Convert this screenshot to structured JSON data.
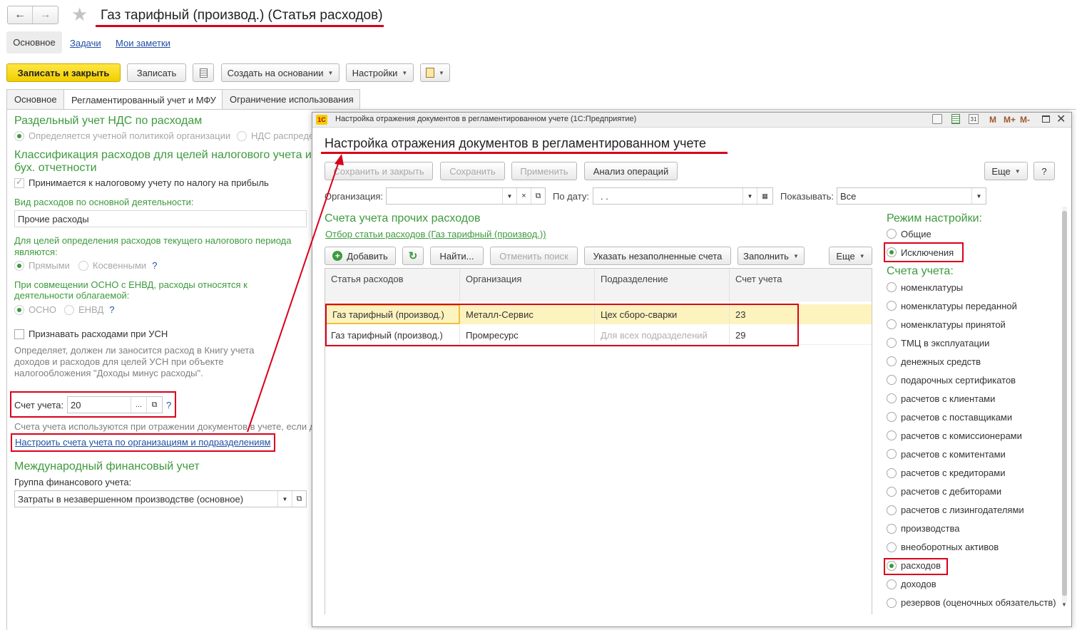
{
  "header": {
    "title": "Газ тарифный (производ.) (Статья расходов)"
  },
  "subnav": {
    "main": "Основное",
    "tasks": "Задачи",
    "notes": "Мои заметки"
  },
  "toolbar": {
    "save_close": "Записать и закрыть",
    "save": "Записать",
    "create_basis": "Создать на основании",
    "settings": "Настройки"
  },
  "tabs": [
    "Основное",
    "Регламентированный учет и МФУ",
    "Ограничение использования"
  ],
  "left": {
    "vat_title": "Раздельный учет НДС по расходам",
    "vat_opt1": "Определяется учетной политикой организации",
    "vat_opt2": "НДС распреде",
    "class_title_1": "Классификация расходов для целей налогового учета и о",
    "class_title_2": "бух. отчетности",
    "accepted": "Принимается к налоговому учету по налогу на прибыль",
    "kind_label": "Вид расходов по основной деятельности:",
    "kind_value": "Прочие расходы",
    "purpose_1": "Для целей определения расходов текущего налогового периода",
    "purpose_2": "являются:",
    "direct": "Прямыми",
    "indirect": "Косвенными",
    "q": "?",
    "envd_1": "При совмещении ОСНО с ЕНВД, расходы относятся к",
    "envd_2": "деятельности облагаемой:",
    "osno": "ОСНО",
    "envd": "ЕНВД",
    "usn_cb": "Признавать расходами при УСН",
    "usn_note_1": "Определяет, должен ли заносится расход в Книгу учета",
    "usn_note_2": "доходов и расходов для целей УСН при объекте",
    "usn_note_3": "налогообложения \"Доходы минус расходы\".",
    "account_label": "Счет учета:",
    "account_value": "20",
    "account_dots": "...",
    "account_note": "Счета учета используются при отражении документов в учете, если д",
    "configure_link": "Настроить счета учета по организациям и подразделениям",
    "ifrs_title": "Международный финансовый учет",
    "ifrs_group_label": "Группа финансового учета:",
    "ifrs_group_value": "Затраты в незавершенном производстве (основное)"
  },
  "dialog": {
    "window_title": "Настройка отражения документов в регламентированном учете  (1С:Предприятие)",
    "logo": "1С",
    "win_btns": [
      "M",
      "M+",
      "M-"
    ],
    "title": "Настройка отражения документов в регламентированном учете",
    "btn_save_close": "Сохранить и закрыть",
    "btn_save": "Сохранить",
    "btn_apply": "Применить",
    "btn_analysis": "Анализ операций",
    "btn_more": "Еще",
    "btn_help": "?",
    "org_label": "Организация:",
    "org_value": "",
    "date_label": "По дату:",
    "date_value": ". .",
    "show_label": "Показывать:",
    "show_value": "Все",
    "accounts_title": "Счета учета прочих расходов",
    "filter_link": "Отбор статьи расходов (Газ тарифный (производ.))",
    "btn_add": "Добавить",
    "btn_find": "Найти...",
    "btn_cancel_search": "Отменить поиск",
    "btn_unfilled": "Указать незаполненные счета",
    "btn_fill": "Заполнить",
    "btn_more2": "Еще",
    "columns": [
      "Статья расходов",
      "Организация",
      "Подразделение",
      "Счет учета"
    ],
    "rows": [
      {
        "item": "Газ тарифный (производ.)",
        "org": "Металл-Сервис",
        "dept": "Цех сборо-сварки",
        "account": "23"
      },
      {
        "item": "Газ тарифный (производ.)",
        "org": "Промресурс",
        "dept": "Для всех подразделений",
        "account": "29"
      }
    ],
    "mode_title": "Режим настройки:",
    "mode_general": "Общие",
    "mode_exceptions": "Исключения",
    "acc_title": "Счета учета:",
    "acc_options": [
      "номенклатуры",
      "номенклатуры переданной",
      "номенклатуры принятой",
      "ТМЦ в эксплуатации",
      "денежных средств",
      "подарочных сертификатов",
      "расчетов с клиентами",
      "расчетов с поставщиками",
      "расчетов с комиссионерами",
      "расчетов с комитентами",
      "расчетов с кредиторами",
      "расчетов с дебиторами",
      "расчетов с лизингодателями",
      "производства",
      "внеоборотных активов",
      "расходов",
      "доходов",
      "резервов (оценочных обязательств)"
    ],
    "acc_selected": "расходов"
  },
  "colors": {
    "accent_green": "#3d9a3d",
    "highlight_red": "#d9001b",
    "link_blue": "#2250a6",
    "yellow_btn": "#f2cf00",
    "selected_row": "#fdf3bf"
  }
}
